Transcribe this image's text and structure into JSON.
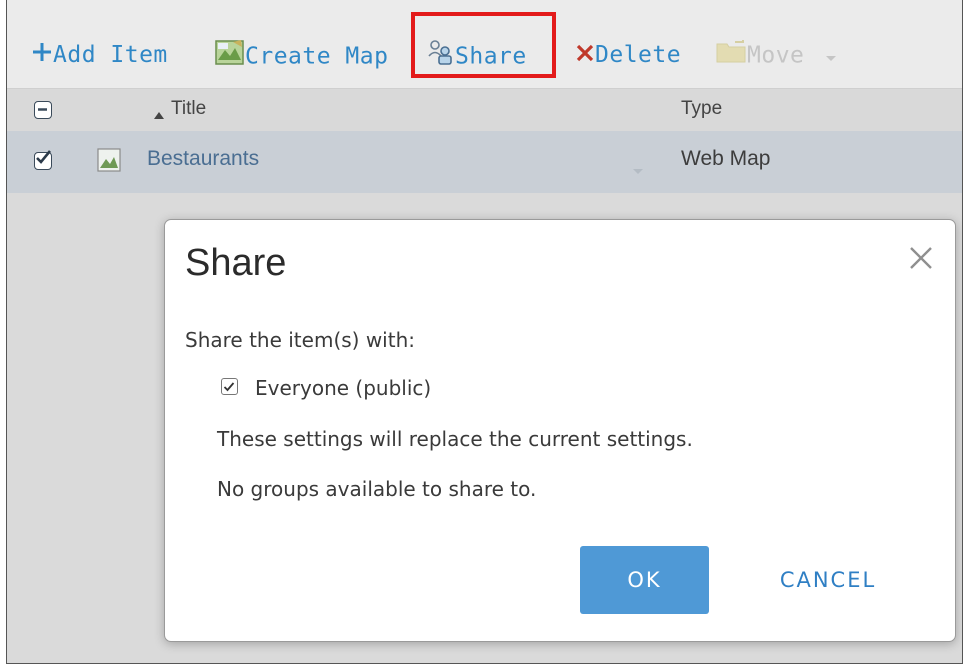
{
  "toolbar": {
    "add_item": "Add Item",
    "create_map": "Create Map",
    "share": "Share",
    "delete": "Delete",
    "move": "Move"
  },
  "grid": {
    "columns": [
      "Title",
      "Type"
    ],
    "rows": [
      {
        "title": "Bestaurants",
        "type": "Web Map",
        "checked": true
      }
    ]
  },
  "dialog": {
    "title": "Share",
    "prompt": "Share the item(s) with:",
    "option_everyone": "Everyone (public)",
    "option_everyone_checked": true,
    "note_replace": "These settings will replace the current settings.",
    "note_groups": "No groups available to share to.",
    "ok_label": "OK",
    "cancel_label": "CANCEL"
  },
  "colors": {
    "accent": "#2f87c6",
    "ok_button": "#4f99d6",
    "highlight": "#e31b1b"
  }
}
